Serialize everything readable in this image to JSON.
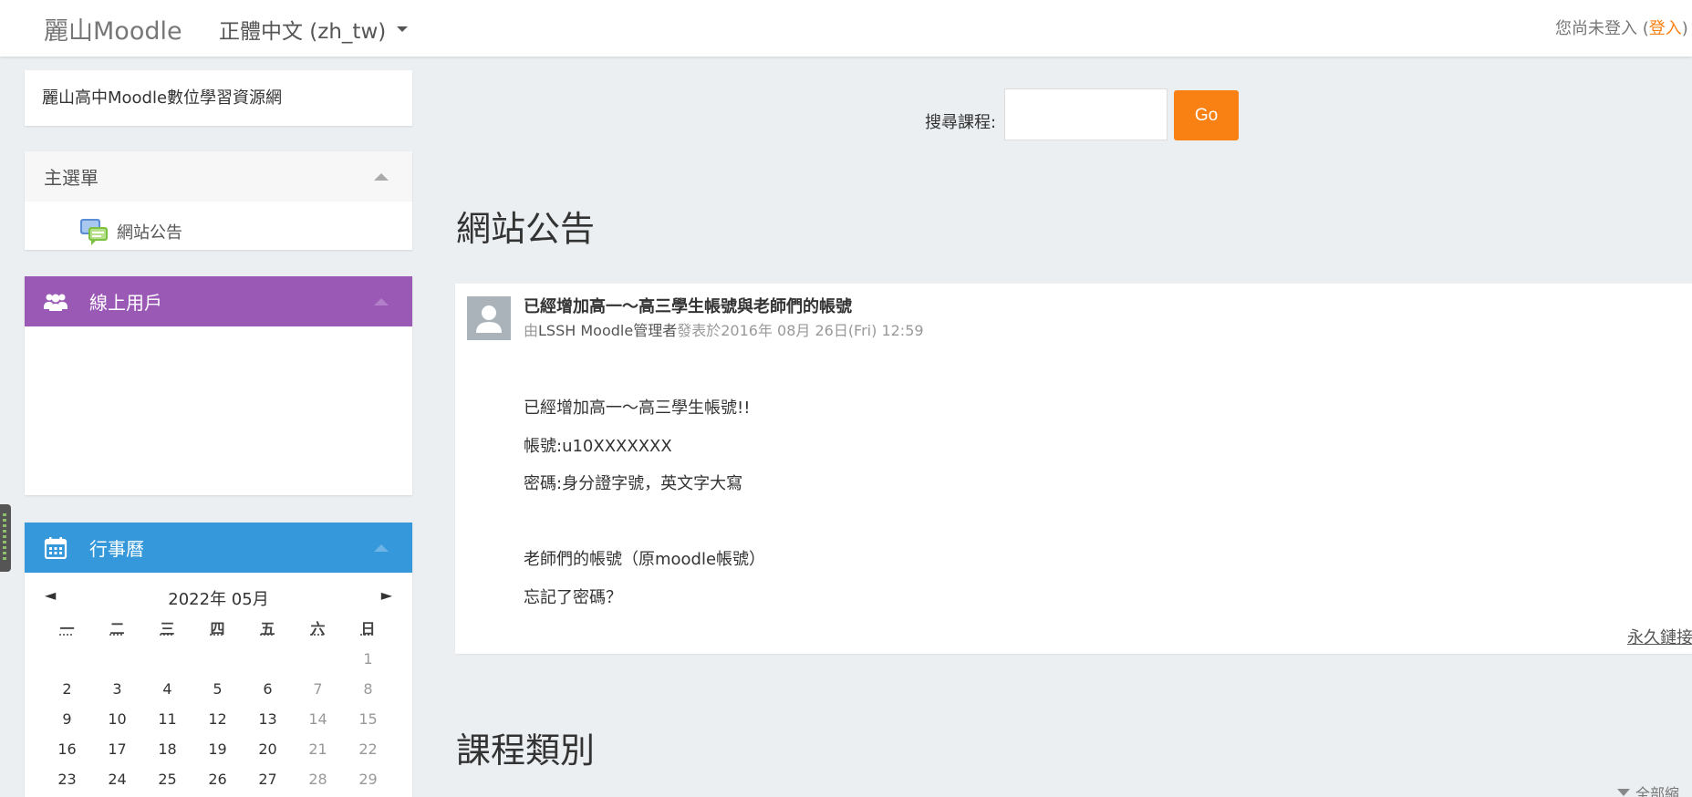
{
  "header": {
    "brand": "麗山Moodle",
    "language": "正體中文 ‎(zh_tw)‎",
    "login_prefix": "您尚未登入 (",
    "login_link": "登入",
    "login_suffix": ")"
  },
  "sidebar": {
    "site_name": "麗山高中Moodle數位學習資源網",
    "main_menu": {
      "title": "主選單",
      "items": [
        {
          "label": "網站公告",
          "icon": "forum-icon"
        }
      ]
    },
    "online_users": {
      "title": "線上用戶",
      "icon": "users-icon"
    },
    "calendar": {
      "title": "行事曆",
      "icon": "calendar-icon",
      "prev": "◄",
      "next": "►",
      "month_label": "2022年 05月",
      "weekdays": [
        "一",
        "二",
        "三",
        "四",
        "五",
        "六",
        "日"
      ],
      "weeks": [
        [
          "",
          "",
          "",
          "",
          "",
          "",
          "1"
        ],
        [
          "2",
          "3",
          "4",
          "5",
          "6",
          "7",
          "8"
        ],
        [
          "9",
          "10",
          "11",
          "12",
          "13",
          "14",
          "15"
        ],
        [
          "16",
          "17",
          "18",
          "19",
          "20",
          "21",
          "22"
        ],
        [
          "23",
          "24",
          "25",
          "26",
          "27",
          "28",
          "29"
        ]
      ]
    }
  },
  "main": {
    "search": {
      "label": "搜尋課程:",
      "value": "",
      "button": "Go"
    },
    "news_title": "網站公告",
    "post": {
      "subject": "已經增加高一～高三學生帳號與老師們的帳號",
      "byline_prefix": "由",
      "author": "LSSH Moodle管理者",
      "byline_date": "發表於2016年 08月 26日(Fri) 12:59",
      "lines": [
        "已經增加高一～高三學生帳號!!",
        "帳號:u10XXXXXXX",
        "密碼:身分證字號，英文字大寫",
        "老師們的帳號（原moodle帳號）",
        " 忘記了密碼？"
      ],
      "permalink": "永久鏈接"
    },
    "course_title": "課程類別",
    "collapse_all": "全部縮"
  },
  "colors": {
    "accent": "#f98012",
    "online_header": "#9b59b6",
    "calendar_header": "#3498db"
  }
}
